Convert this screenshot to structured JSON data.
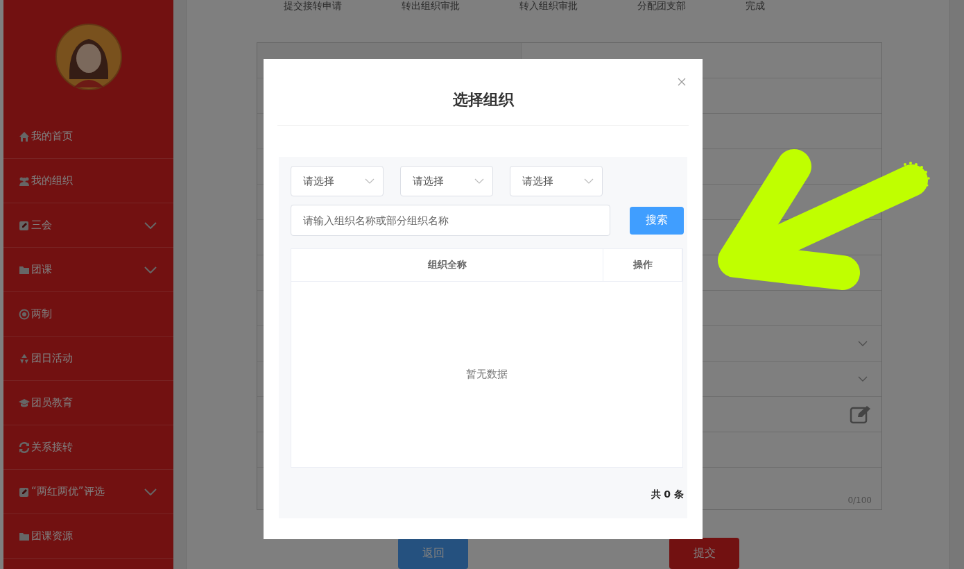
{
  "steps": [
    "提交接转申请",
    "转出组织审批",
    "转入组织审批",
    "分配团支部",
    "完成"
  ],
  "sidebar": {
    "items": [
      {
        "label": "我的首页",
        "kind": "home",
        "expandable": false
      },
      {
        "label": "我的组织",
        "kind": "group",
        "expandable": false
      },
      {
        "label": "三会",
        "kind": "edit",
        "expandable": true
      },
      {
        "label": "团课",
        "kind": "folder",
        "expandable": true
      },
      {
        "label": "两制",
        "kind": "target",
        "expandable": false
      },
      {
        "label": "团日活动",
        "kind": "recycle",
        "expandable": false
      },
      {
        "label": "团员教育",
        "kind": "cap",
        "expandable": false
      },
      {
        "label": "关系接转",
        "kind": "refresh",
        "expandable": false
      },
      {
        "label": "“两红两优”评选",
        "kind": "edit",
        "expandable": true
      },
      {
        "label": "团课资源",
        "kind": "folder",
        "expandable": false
      }
    ]
  },
  "form": {
    "rows": [
      {
        "kind": "text"
      },
      {
        "kind": "text"
      },
      {
        "kind": "text"
      },
      {
        "kind": "text"
      },
      {
        "kind": "text"
      },
      {
        "kind": "text"
      },
      {
        "kind": "text"
      },
      {
        "kind": "text"
      },
      {
        "kind": "select"
      },
      {
        "kind": "select"
      },
      {
        "kind": "edit"
      },
      {
        "kind": "text"
      }
    ],
    "counter": "0/100"
  },
  "buttons": [
    {
      "label": "返回",
      "kind": "back"
    },
    {
      "label": "提交",
      "kind": "submit"
    }
  ],
  "dialog": {
    "title": "选择组织",
    "selects": [
      {
        "placeholder": "请选择"
      },
      {
        "placeholder": "请选择"
      },
      {
        "placeholder": "请选择"
      }
    ],
    "search": {
      "placeholder": "请输入组织名称或部分组织名称"
    },
    "search_button": "搜索",
    "table": {
      "columns": [
        "组织全称",
        "操作"
      ],
      "empty": "暂无数据"
    },
    "total": "共 0 条"
  }
}
